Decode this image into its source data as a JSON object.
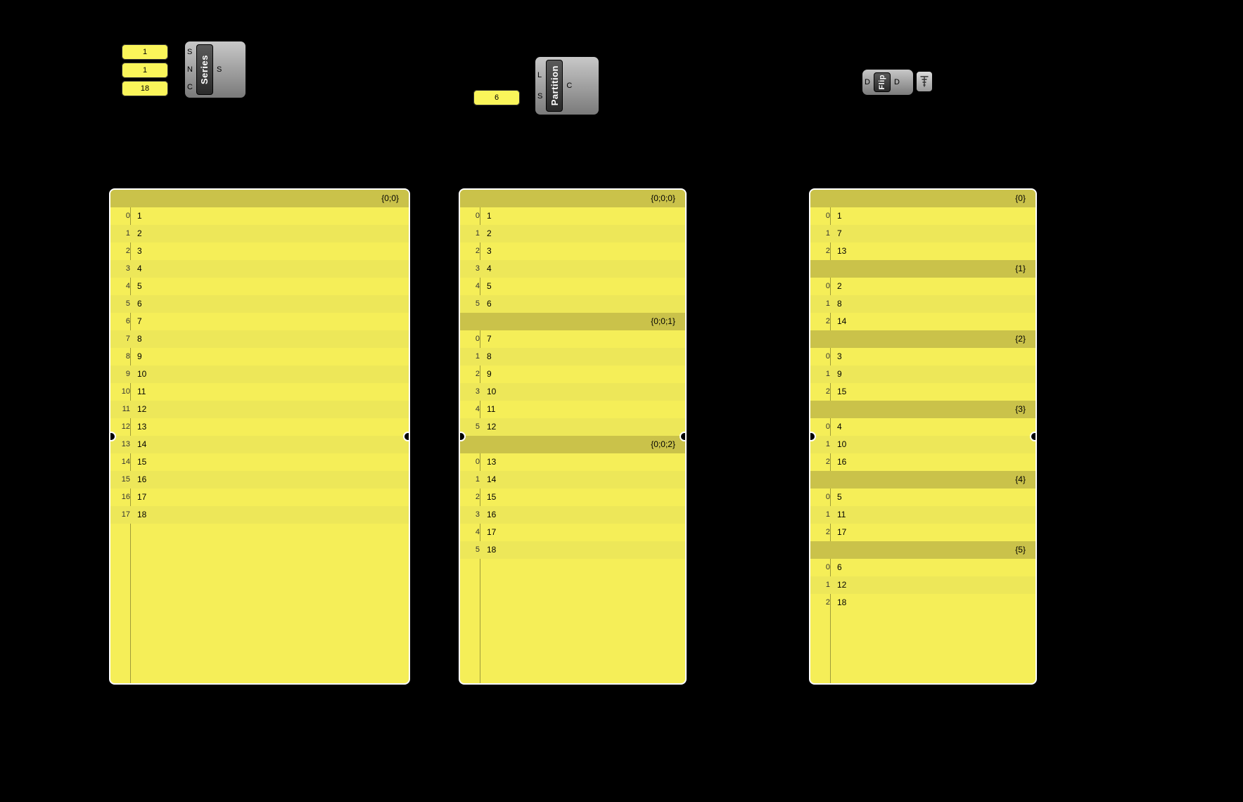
{
  "params": {
    "series_start": "1",
    "series_step": "1",
    "series_count": "18",
    "partition_size": "6"
  },
  "components": {
    "series": {
      "label": "Series",
      "inputs": [
        "S",
        "N",
        "C"
      ],
      "outputs": [
        "S"
      ]
    },
    "partition": {
      "label": "Partition",
      "inputs": [
        "L",
        "S"
      ],
      "outputs": [
        "C"
      ]
    },
    "flip": {
      "label": "Flip",
      "inputs": [
        "D"
      ],
      "outputs": [
        "D"
      ]
    }
  },
  "panels": {
    "series_out": {
      "branches": [
        {
          "path": "{0;0}",
          "items": [
            "1",
            "2",
            "3",
            "4",
            "5",
            "6",
            "7",
            "8",
            "9",
            "10",
            "11",
            "12",
            "13",
            "14",
            "15",
            "16",
            "17",
            "18"
          ]
        }
      ]
    },
    "partition_out": {
      "branches": [
        {
          "path": "{0;0;0}",
          "items": [
            "1",
            "2",
            "3",
            "4",
            "5",
            "6"
          ]
        },
        {
          "path": "{0;0;1}",
          "items": [
            "7",
            "8",
            "9",
            "10",
            "11",
            "12"
          ]
        },
        {
          "path": "{0;0;2}",
          "items": [
            "13",
            "14",
            "15",
            "16",
            "17",
            "18"
          ]
        }
      ]
    },
    "flip_out": {
      "branches": [
        {
          "path": "{0}",
          "items": [
            "1",
            "7",
            "13"
          ]
        },
        {
          "path": "{1}",
          "items": [
            "2",
            "8",
            "14"
          ]
        },
        {
          "path": "{2}",
          "items": [
            "3",
            "9",
            "15"
          ]
        },
        {
          "path": "{3}",
          "items": [
            "4",
            "10",
            "16"
          ]
        },
        {
          "path": "{4}",
          "items": [
            "5",
            "11",
            "17"
          ]
        },
        {
          "path": "{5}",
          "items": [
            "6",
            "12",
            "18"
          ]
        }
      ]
    }
  }
}
